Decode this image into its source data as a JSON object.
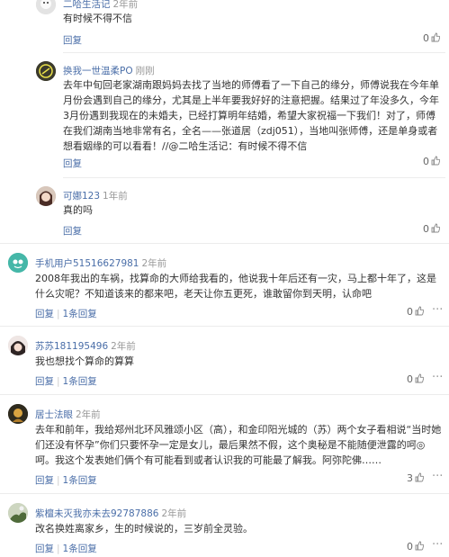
{
  "comments": [
    {
      "user": "二哈生活记",
      "time": "2年前",
      "text": "有时候不得不信",
      "reply": "回复",
      "likes": "0"
    },
    {
      "user": "换我一世温柔PO",
      "time": "刚刚",
      "text": "去年中旬回老家湖南跟妈妈去找了当地的师傅看了一下自己的缘分，师傅说我在今年单月份会遇到自己的缘分，尤其是上半年要我好好的注意把握。结果过了年没多久，今年3月份遇到我现在的未婚夫，已经打算明年结婚，希望大家祝福一下我们！对了，师傅在我们湖南当地非常有名，全名——张道居（zdj051），当地叫张师傅，还是单身或者想看姻缘的可以看看！//@二哈生活记：有时候不得不信",
      "reply": "回复",
      "likes": "0"
    },
    {
      "user": "可娜123",
      "time": "1年前",
      "text": "真的吗",
      "reply": "回复",
      "likes": "0"
    },
    {
      "user": "手机用户51516627981",
      "time": "2年前",
      "text": "2008年我出的车祸，找算命的大师给我看的，他说我十年后还有一灾，马上都十年了，这是什么灾呢？不知道该来的都来吧，老天让你五更死，谁敢留你到天明，认命吧",
      "reply": "回复",
      "reply_count": "1条回复",
      "likes": "0"
    },
    {
      "user": "苏苏181195496",
      "time": "2年前",
      "text": "我也想找个算命的算算",
      "reply": "回复",
      "reply_count": "1条回复",
      "likes": "0"
    },
    {
      "user": "居士法眼",
      "time": "2年前",
      "text": "去年和前年，我给郑州北环风雅颂小区（高），和金印阳光城的（苏）两个女子看相说“当时她们还没有怀孕”你们只要怀孕一定是女儿，最后果然不假，这个奥秘是不能随便泄露的呵◎呵。我这个发表她们俩个有可能看到或者认识我的可能最了解我。阿弥陀佛……",
      "reply": "回复",
      "reply_count": "1条回复",
      "likes": "3"
    },
    {
      "user": "紫檀未灭我亦未去92787886",
      "time": "2年前",
      "text": "改名换姓离家乡，生的时候说的，三岁前全灵验。",
      "reply": "回复",
      "reply_count": "1条回复",
      "likes": "0"
    }
  ],
  "icons": {
    "like": "thumbs-up-icon"
  },
  "colors": {
    "username": "#4a6ea8",
    "meta": "#999999",
    "text": "#333333"
  }
}
